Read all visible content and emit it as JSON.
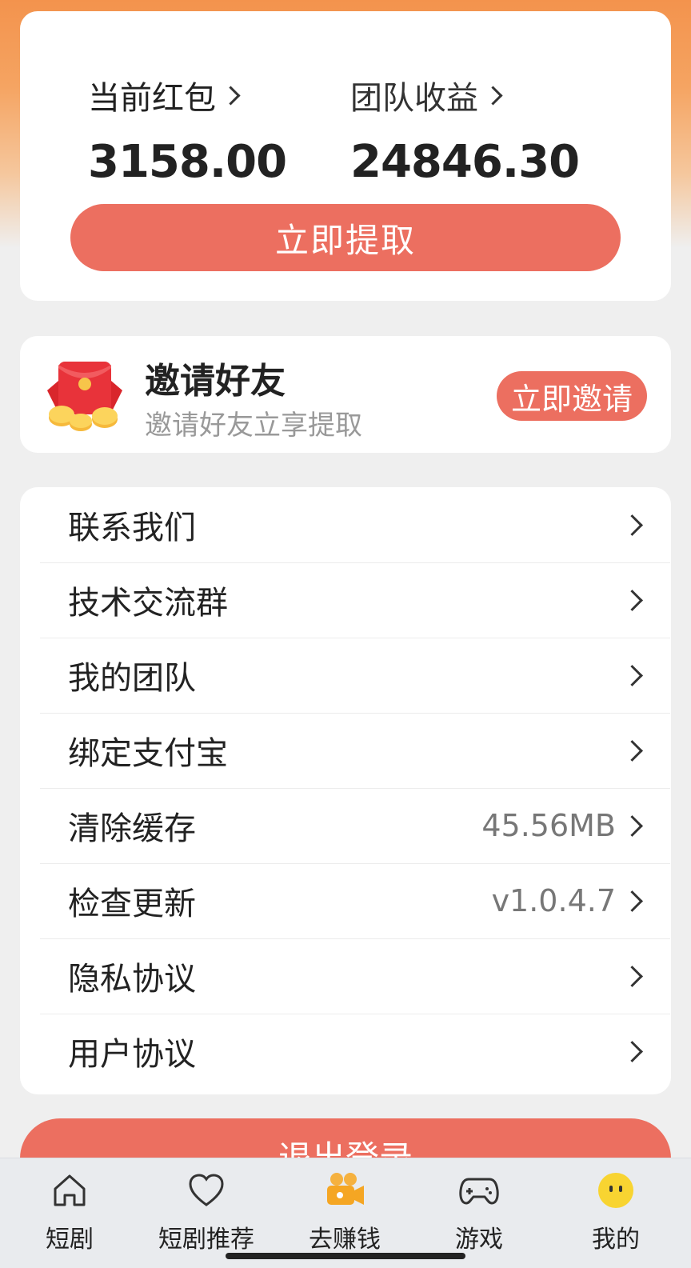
{
  "balance": {
    "red_packet_label": "当前红包",
    "red_packet_value": "3158.00",
    "team_income_label": "团队收益",
    "team_income_value": "24846.30",
    "withdraw_button": "立即提取"
  },
  "invite": {
    "title": "邀请好友",
    "subtitle": "邀请好友立享提取",
    "button": "立即邀请",
    "icon": "red-envelope-coins-icon"
  },
  "menu": [
    {
      "label": "联系我们",
      "value": ""
    },
    {
      "label": "技术交流群",
      "value": ""
    },
    {
      "label": "我的团队",
      "value": ""
    },
    {
      "label": "绑定支付宝",
      "value": ""
    },
    {
      "label": "清除缓存",
      "value": "45.56MB"
    },
    {
      "label": "检查更新",
      "value": "v1.0.4.7"
    },
    {
      "label": "隐私协议",
      "value": ""
    },
    {
      "label": "用户协议",
      "value": ""
    }
  ],
  "logout_button": "退出登录",
  "tabs": [
    {
      "label": "短剧",
      "icon": "home-icon"
    },
    {
      "label": "短剧推荐",
      "icon": "heart-icon"
    },
    {
      "label": "去赚钱",
      "icon": "video-camera-icon",
      "active": true
    },
    {
      "label": "游戏",
      "icon": "gamepad-icon"
    },
    {
      "label": "我的",
      "icon": "smiley-icon"
    }
  ],
  "colors": {
    "accent": "#ec6f60",
    "header_gradient_top": "#f3934d"
  }
}
